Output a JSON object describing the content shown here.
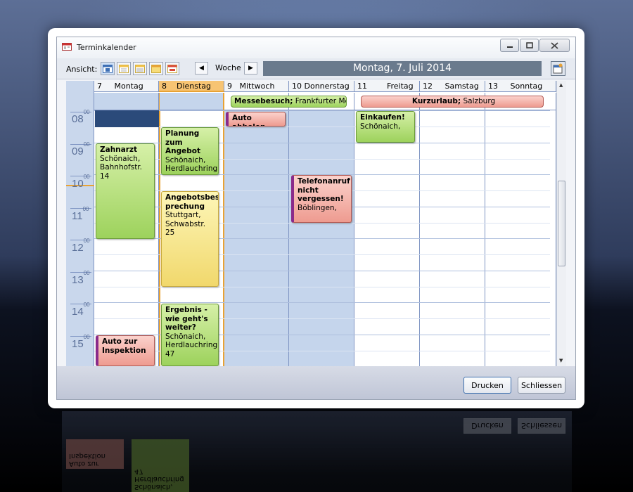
{
  "window": {
    "title": "Terminkalender"
  },
  "toolbar": {
    "ansicht_label": "Ansicht:",
    "view_mode": "Woche",
    "current_date": "Montag, 7. Juli 2014"
  },
  "days": [
    {
      "num": "7",
      "name": "Montag"
    },
    {
      "num": "8",
      "name": "Dienstag"
    },
    {
      "num": "9",
      "name": "Mittwoch"
    },
    {
      "num": "10",
      "name": "Donnerstag"
    },
    {
      "num": "11",
      "name": "Freitag"
    },
    {
      "num": "12",
      "name": "Samstag"
    },
    {
      "num": "13",
      "name": "Sonntag"
    }
  ],
  "hours": [
    "08",
    "09",
    "10",
    "11",
    "12",
    "13",
    "14",
    "15"
  ],
  "minutes_label": "00",
  "all_day": [
    {
      "title": "Messebesuch;",
      "detail": "Frankfurter Messe"
    },
    {
      "title": "Kurzurlaub;",
      "detail": "Salzburg"
    }
  ],
  "appointments": {
    "zahnarzt": {
      "title": "Zahnarzt",
      "detail": "Schönaich, Bahnhofstr. 14"
    },
    "inspektion": {
      "title": "Auto zur Inspektion",
      "detail": ""
    },
    "planung": {
      "title": "Planung zum Angebot",
      "detail": "Schönaich, Herdlauchring"
    },
    "angebotsbesprechung": {
      "title": "Angebotsbes prechung",
      "detail": "Stuttgart, Schwabstr. 25"
    },
    "ergebnis": {
      "title": "Ergebnis - wie geht's weiter?",
      "detail": "Schönaich, Herdlauchring 47"
    },
    "auto_abholen": {
      "title": "Auto abholen",
      "detail": ""
    },
    "telefonanruf": {
      "title": "Telefonanruf nicht vergessen!",
      "detail": "Böblingen,"
    },
    "einkaufen": {
      "title": "Einkaufen!",
      "detail": "Schönaich,"
    }
  },
  "footer": {
    "print_label": "Drucken",
    "close_label": "Schliessen"
  },
  "colors": {
    "today": "#f7c473",
    "workday_blue": "#c5d5ec",
    "date_bar": "#6a7a8d"
  }
}
